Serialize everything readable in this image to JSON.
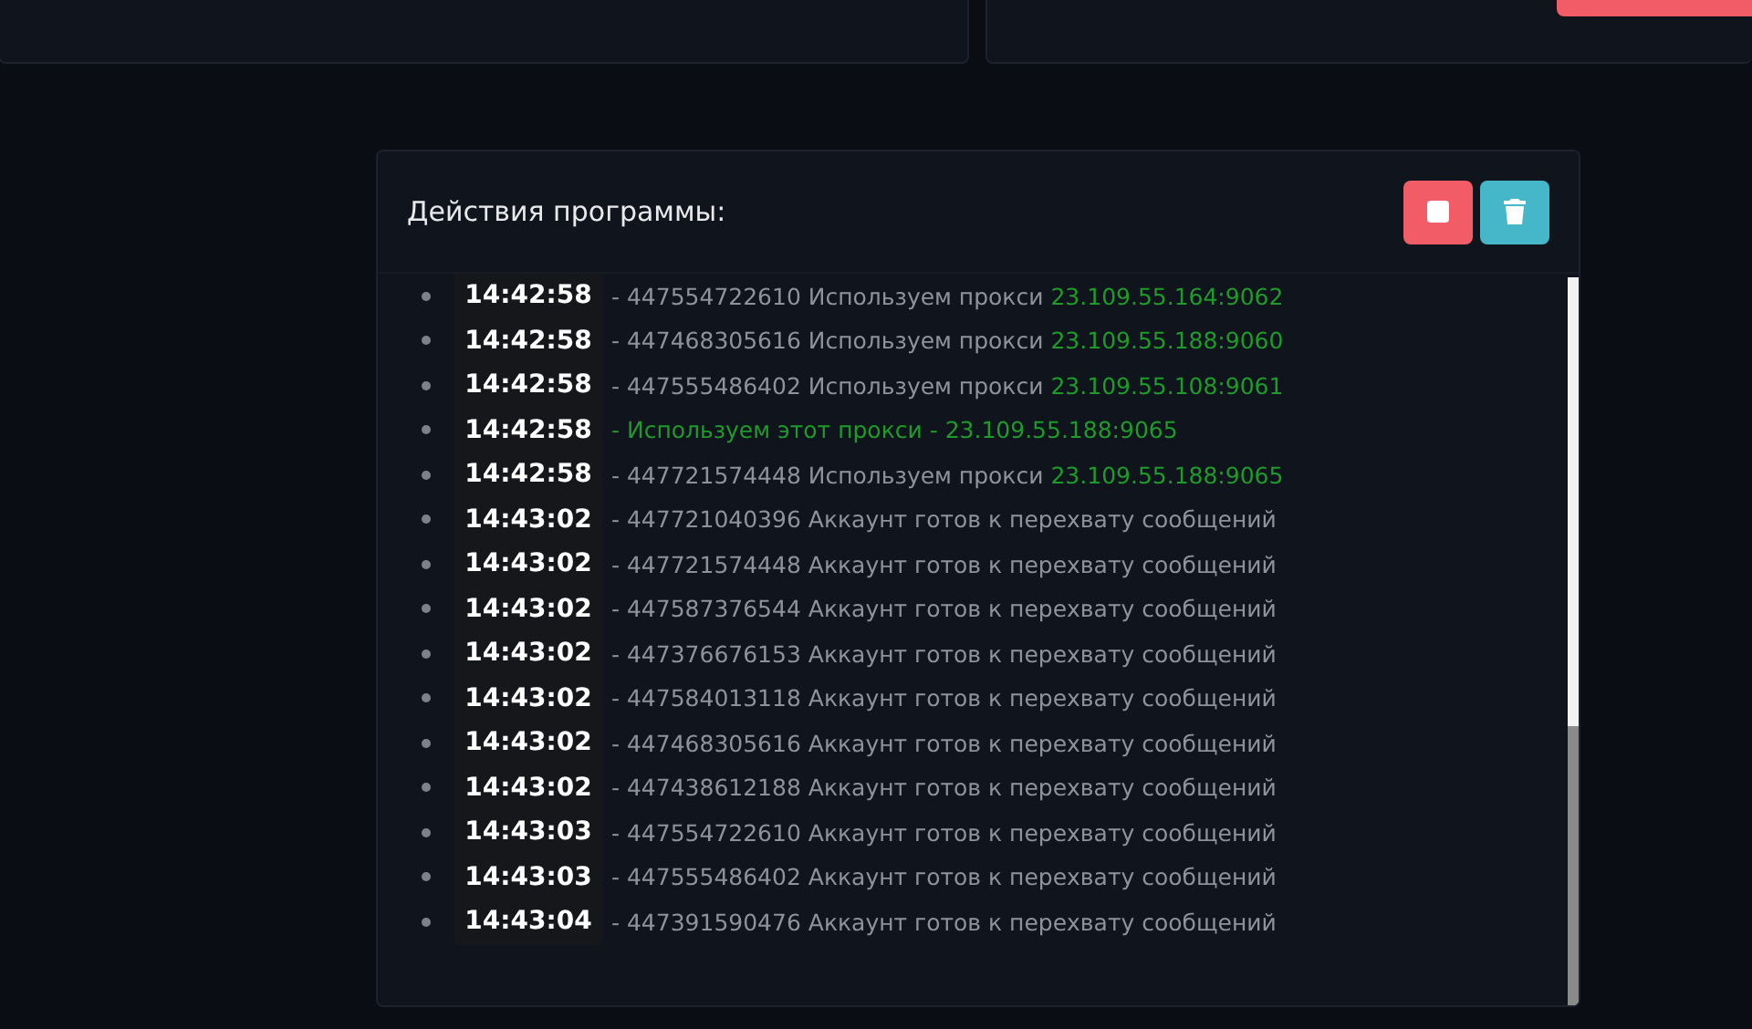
{
  "log_panel": {
    "title": "Действия программы:",
    "entries": [
      {
        "kind": "proxy",
        "time": "14:42:58",
        "text": "- 447554722610 Используем прокси",
        "proxy": "23.109.55.164:9062"
      },
      {
        "kind": "proxy",
        "time": "14:42:58",
        "text": "- 447468305616 Используем прокси",
        "proxy": "23.109.55.188:9060"
      },
      {
        "kind": "proxy",
        "time": "14:42:58",
        "text": "- 447555486402 Используем прокси",
        "proxy": "23.109.55.108:9061"
      },
      {
        "kind": "notice",
        "time": "14:42:58",
        "text": "- Используем этот прокси - 23.109.55.188:9065"
      },
      {
        "kind": "proxy",
        "time": "14:42:58",
        "text": "- 447721574448 Используем прокси",
        "proxy": "23.109.55.188:9065"
      },
      {
        "kind": "ready",
        "time": "14:43:02",
        "text": "- 447721040396 Аккаунт готов к перехвату сообщений"
      },
      {
        "kind": "ready",
        "time": "14:43:02",
        "text": "- 447721574448 Аккаунт готов к перехвату сообщений"
      },
      {
        "kind": "ready",
        "time": "14:43:02",
        "text": "- 447587376544 Аккаунт готов к перехвату сообщений"
      },
      {
        "kind": "ready",
        "time": "14:43:02",
        "text": "- 447376676153 Аккаунт готов к перехвату сообщений"
      },
      {
        "kind": "ready",
        "time": "14:43:02",
        "text": "- 447584013118 Аккаунт готов к перехвату сообщений"
      },
      {
        "kind": "ready",
        "time": "14:43:02",
        "text": "- 447468305616 Аккаунт готов к перехвату сообщений"
      },
      {
        "kind": "ready",
        "time": "14:43:02",
        "text": "- 447438612188 Аккаунт готов к перехвату сообщений"
      },
      {
        "kind": "ready",
        "time": "14:43:03",
        "text": "- 447554722610 Аккаунт готов к перехвату сообщений"
      },
      {
        "kind": "ready",
        "time": "14:43:03",
        "text": "- 447555486402 Аккаунт готов к перехвату сообщений"
      },
      {
        "kind": "ready",
        "time": "14:43:04",
        "text": "- 447391590476 Аккаунт готов к перехвату сообщений"
      }
    ]
  }
}
